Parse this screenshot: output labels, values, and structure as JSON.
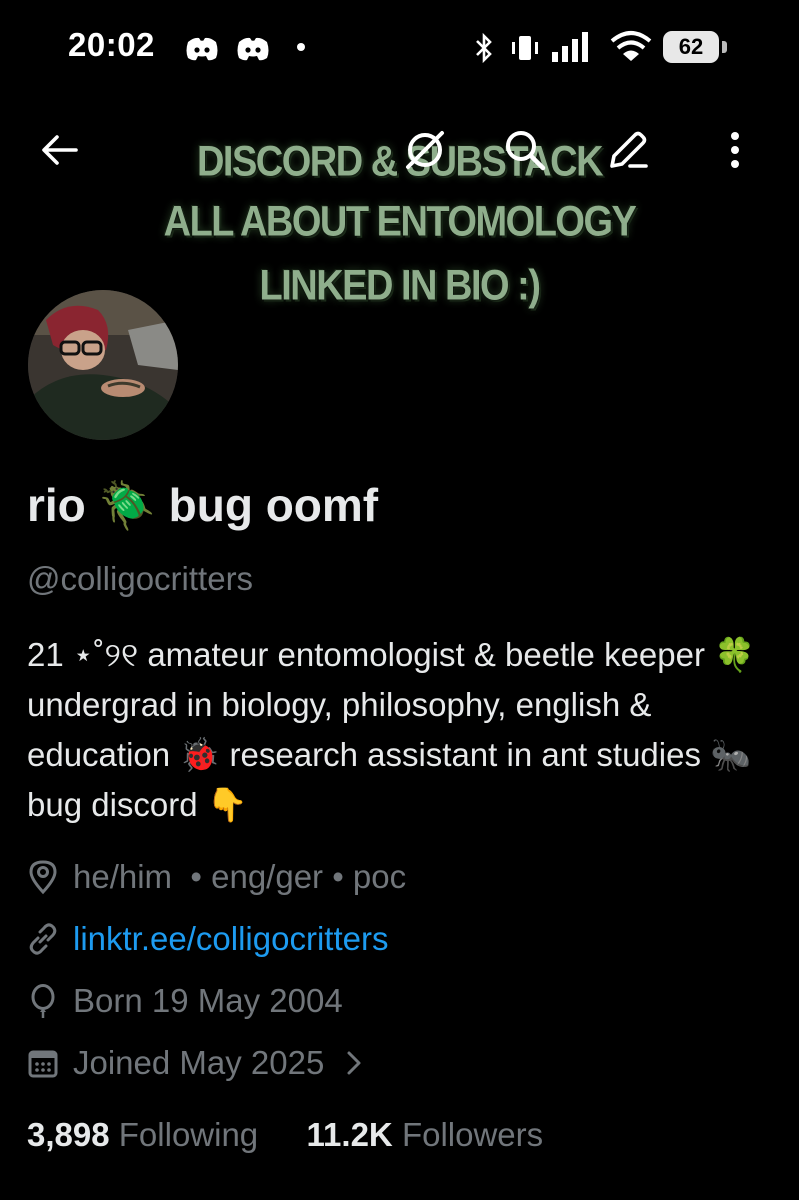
{
  "status_bar": {
    "time": "20:02",
    "battery": "62"
  },
  "banner": {
    "line1": "DISCORD & SUBSTACK",
    "line2": "ALL ABOUT ENTOMOLOGY",
    "line3": "LINKED IN BIO :)"
  },
  "profile": {
    "display_name": "rio 🪲 bug oomf",
    "handle": "@colligocritters",
    "bio": "21 ⋆˚୨୧ amateur entomologist & beetle keeper 🍀 undergrad in biology, philosophy, english & education 🐞 research assistant in ant studies 🐜 bug discord 👇",
    "location": "he/him  • eng/ger • poc",
    "website": "linktr.ee/colligocritters",
    "born": "Born 19 May 2004",
    "joined": "Joined May 2025",
    "following_count": "3,898",
    "following_label": "Following",
    "followers_count": "11.2K",
    "followers_label": "Followers"
  },
  "colors": {
    "accent": "#1d9bf0",
    "muted": "#71767b",
    "text": "#e7e9ea",
    "banner_text": "#8fae8c"
  },
  "icons": [
    "back-arrow-icon",
    "grok-icon",
    "search-icon",
    "edit-icon",
    "more-icon",
    "location-icon",
    "link-icon",
    "balloon-icon",
    "calendar-icon",
    "chevron-right-icon"
  ]
}
